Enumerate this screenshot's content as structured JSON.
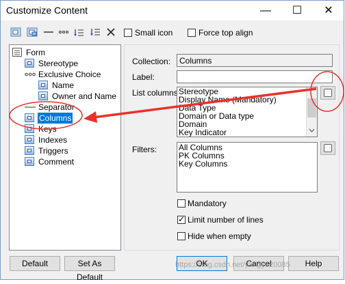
{
  "window": {
    "title": "Customize Content",
    "minimize_glyph": "—",
    "maximize_glyph": "☐",
    "close_glyph": "✕"
  },
  "toolbar": {
    "icons": [
      "add-item-icon",
      "add-subitem-icon",
      "separator-line-icon",
      "separator-dots-icon",
      "move-down-icon",
      "sort-icon",
      "delete-icon"
    ],
    "small_icon_label": "Small icon",
    "force_top_align_label": "Force top align"
  },
  "tree": {
    "root": "Form",
    "items": [
      "Stereotype",
      "Exclusive Choice",
      "Name",
      "Owner and Name",
      "Separator",
      "Columns",
      "Keys",
      "Indexes",
      "Triggers",
      "Comment"
    ],
    "selected": "Columns"
  },
  "props": {
    "collection_label": "Collection:",
    "collection_value": "Columns",
    "label_label": "Label:",
    "label_value": "",
    "list_columns_label": "List columns:",
    "list_columns": [
      "Stereotype",
      "Display Name (Mandatory)",
      "Data Type",
      "Domain or Data type",
      "Domain",
      "Key Indicator"
    ],
    "filters_label": "Filters:",
    "filters": [
      "All Columns",
      "PK Columns",
      "Key Columns"
    ],
    "mandatory_label": "Mandatory",
    "limit_lines_label": "Limit number of lines",
    "hide_empty_label": "Hide when empty",
    "mandatory_checked": false,
    "limit_lines_checked": true,
    "hide_empty_checked": false
  },
  "buttons": {
    "default": "Default",
    "set_as_default": "Set As Default",
    "ok": "OK",
    "cancel": "Cancel",
    "help": "Help"
  },
  "watermark": "https://blog.csdn.net/yangyu20085",
  "colors": {
    "annotation": "#e8322b",
    "selection": "#0078d7"
  }
}
